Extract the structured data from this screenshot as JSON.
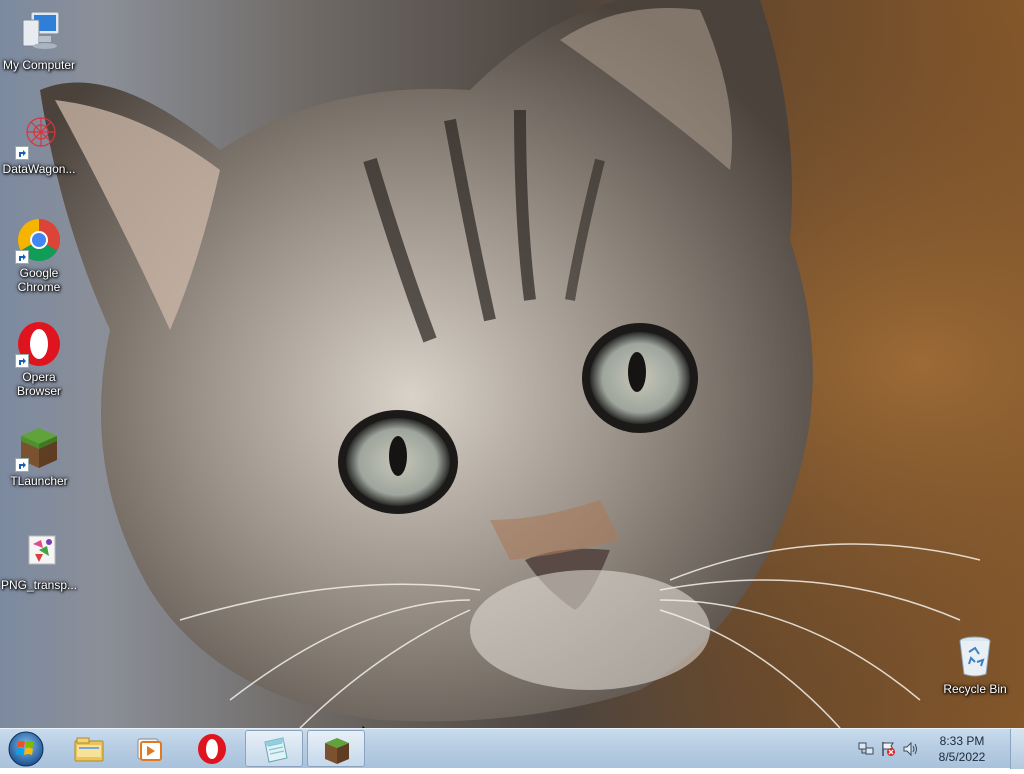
{
  "desktop": {
    "icons": [
      {
        "label": "My Computer",
        "icon": "computer-icon"
      },
      {
        "label": "DataWagon...",
        "icon": "datawagon-icon"
      },
      {
        "label": "Google Chrome",
        "icon": "chrome-icon"
      },
      {
        "label": "Opera Browser",
        "icon": "opera-icon"
      },
      {
        "label": "TLauncher",
        "icon": "tlauncher-icon"
      },
      {
        "label": "PNG_transp...",
        "icon": "png-file-icon"
      },
      {
        "label": "Recycle Bin",
        "icon": "recycle-bin-icon"
      }
    ],
    "wallpaper": "tabby-kitten-photo"
  },
  "taskbar": {
    "start": "windows-start-orb",
    "pinned": [
      {
        "icon": "file-explorer-icon"
      },
      {
        "icon": "media-player-icon"
      },
      {
        "icon": "opera-icon"
      },
      {
        "icon": "notepad-icon"
      },
      {
        "icon": "tlauncher-icon"
      }
    ],
    "tray": {
      "icons": [
        "network-icon",
        "action-center-icon",
        "volume-icon"
      ],
      "time": "8:33 PM",
      "date": "8/5/2022"
    }
  },
  "colors": {
    "taskbar": "#b7cde3",
    "opera_red": "#e0141e",
    "chrome_blue": "#4285f4"
  }
}
